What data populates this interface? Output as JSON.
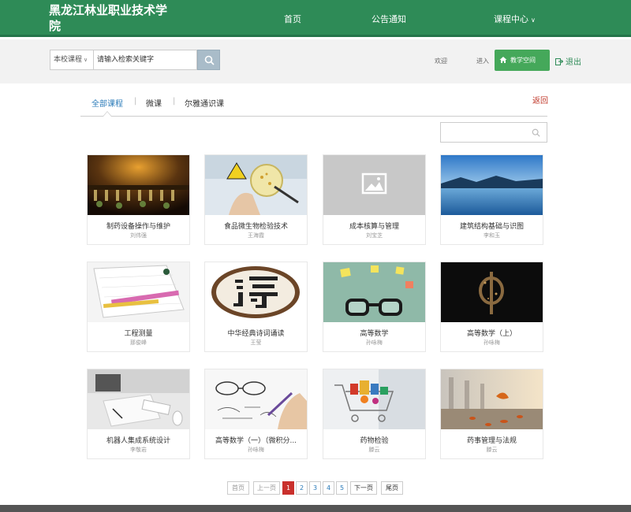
{
  "header": {
    "title": "黑龙江林业职业技术学院",
    "nav": [
      "首页",
      "公告通知",
      "课程中心"
    ]
  },
  "search": {
    "scope": "本校课程",
    "placeholder": "请输入检索关键字",
    "welcome": "欢迎",
    "enter": "进入",
    "space_button": "教学空间",
    "logout": "退出"
  },
  "tabs": [
    "全部课程",
    "微课",
    "尔雅通识课"
  ],
  "back": "返回",
  "courses": [
    {
      "name": "制药设备操作与维护",
      "teacher": "刘伟强"
    },
    {
      "name": "食品微生物检验技术",
      "teacher": "王海霞"
    },
    {
      "name": "成本核算与管理",
      "teacher": "刘宝芝"
    },
    {
      "name": "建筑结构基础与识图",
      "teacher": "李和玉"
    },
    {
      "name": "工程测量",
      "teacher": "那俊峰"
    },
    {
      "name": "中华经典诗词诵读",
      "teacher": "王莹"
    },
    {
      "name": "高等数学",
      "teacher": "孙咏梅"
    },
    {
      "name": "高等数学（上）",
      "teacher": "孙咏梅"
    },
    {
      "name": "机器人集成系统设计",
      "teacher": "李敬岩"
    },
    {
      "name": "高等数学（一）（微积分...",
      "teacher": "孙咏梅"
    },
    {
      "name": "药物检验",
      "teacher": "滕云"
    },
    {
      "name": "药事管理与法规",
      "teacher": "滕云"
    }
  ],
  "pagination": {
    "first": "首页",
    "prev": "上一页",
    "pages": [
      "1",
      "2",
      "3",
      "4",
      "5"
    ],
    "next": "下一页",
    "last": "尾页"
  },
  "colors": {
    "brand": "#2e8b57",
    "accent_red": "#c9302c",
    "link_blue": "#2b7bb9"
  }
}
